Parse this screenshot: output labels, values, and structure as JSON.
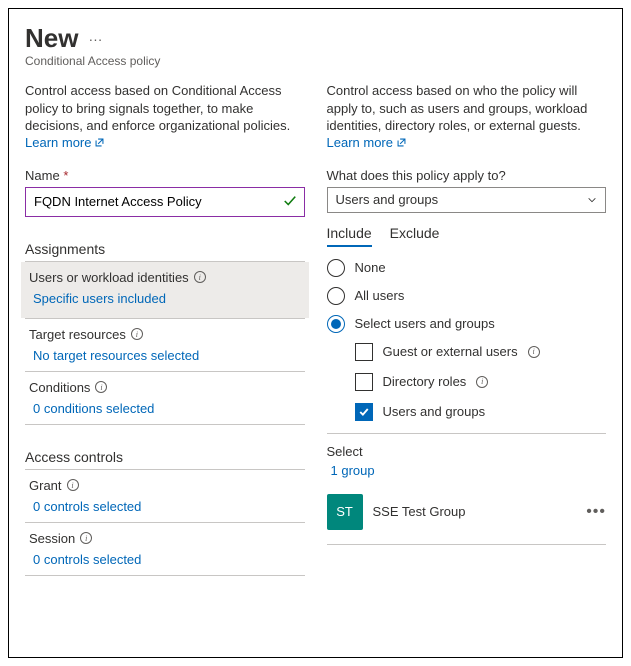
{
  "header": {
    "title": "New",
    "subtitle": "Conditional Access policy"
  },
  "left": {
    "desc": "Control access based on Conditional Access policy to bring signals together, to make decisions, and enforce organizational policies.",
    "learn": "Learn more",
    "name_label": "Name",
    "name_value": "FQDN Internet Access Policy",
    "assignments_heading": "Assignments",
    "users_row": "Users or workload identities",
    "users_value": "Specific users included",
    "target_row": "Target resources",
    "target_value": "No target resources selected",
    "conditions_row": "Conditions",
    "conditions_value": "0 conditions selected",
    "access_heading": "Access controls",
    "grant_row": "Grant",
    "grant_value": "0 controls selected",
    "session_row": "Session",
    "session_value": "0 controls selected"
  },
  "right": {
    "desc": "Control access based on who the policy will apply to, such as users and groups, workload identities, directory roles, or external guests.",
    "learn": "Learn more",
    "apply_label": "What does this policy apply to?",
    "apply_value": "Users and groups",
    "tabs": {
      "include": "Include",
      "exclude": "Exclude"
    },
    "radios": {
      "none": "None",
      "all": "All users",
      "select": "Select users and groups"
    },
    "checks": {
      "guest": "Guest or external users",
      "roles": "Directory roles",
      "groups": "Users and groups"
    },
    "select_label": "Select",
    "select_value": "1 group",
    "group": {
      "initials": "ST",
      "name": "SSE Test Group"
    }
  }
}
